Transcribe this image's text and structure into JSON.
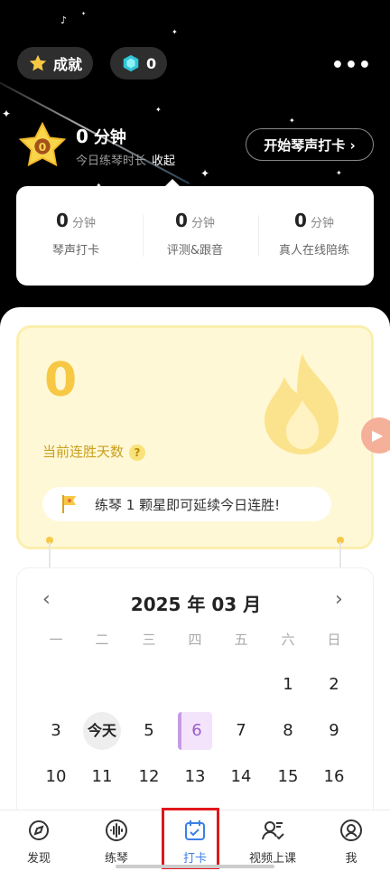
{
  "header": {
    "achievement_label": "成就",
    "gem_count": "0",
    "more_label": "•••"
  },
  "practice": {
    "minutes": "0",
    "minutes_unit": "分钟",
    "subtitle": "今日练琴时长",
    "collapse_label": "收起",
    "start_button": "开始琴声打卡 ›",
    "medal_number": "0"
  },
  "stats": [
    {
      "value": "0",
      "unit": "分钟",
      "label": "琴声打卡"
    },
    {
      "value": "0",
      "unit": "分钟",
      "label": "评测&跟音"
    },
    {
      "value": "0",
      "unit": "分钟",
      "label": "真人在线陪练"
    }
  ],
  "streak": {
    "days": "0",
    "label": "当前连胜天数",
    "help": "?",
    "hint": "练琴 1 颗星即可延续今日连胜!"
  },
  "calendar": {
    "title": "2025 年 03 月",
    "prev": "‹",
    "next": "›",
    "weekdays": [
      "一",
      "二",
      "三",
      "四",
      "五",
      "六",
      "日"
    ],
    "rows": [
      [
        "",
        "",
        "",
        "",
        "",
        "1",
        "2"
      ],
      [
        "3",
        "今天",
        "5",
        "6",
        "7",
        "8",
        "9"
      ],
      [
        "10",
        "11",
        "12",
        "13",
        "14",
        "15",
        "16"
      ]
    ],
    "selected_day": "6"
  },
  "nav": {
    "items": [
      {
        "label": "发现",
        "icon": "discover-icon"
      },
      {
        "label": "练琴",
        "icon": "waveform-icon"
      },
      {
        "label": "打卡",
        "icon": "calendar-check-icon"
      },
      {
        "label": "视频上课",
        "icon": "teacher-icon"
      },
      {
        "label": "我",
        "icon": "profile-icon"
      }
    ],
    "active": "打卡"
  },
  "colors": {
    "accent": "#3b7fe6",
    "streak_yellow": "#f7c844",
    "highlight_red": "#e0171c"
  }
}
